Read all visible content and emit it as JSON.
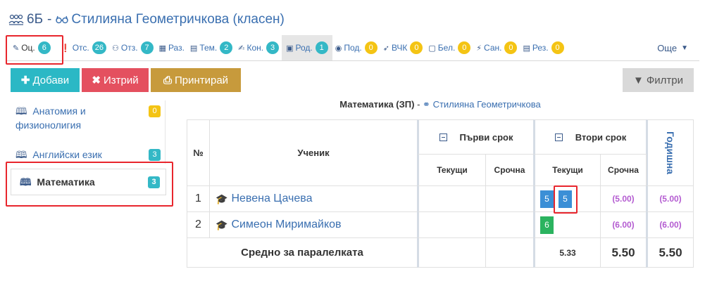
{
  "header": {
    "class_name": "6Б",
    "separator": "-",
    "teacher": "Стилияна Геометричкова (класен)"
  },
  "tabs": [
    {
      "icon": "pencil-icon",
      "label": "Оц.",
      "badge": "6",
      "badge_color": "teal"
    },
    {
      "icon": "exclamation-icon",
      "label": "Отс.",
      "badge": "26",
      "badge_color": "teal"
    },
    {
      "icon": "user-icon",
      "label": "Отз.",
      "badge": "7",
      "badge_color": "teal"
    },
    {
      "icon": "grid-icon",
      "label": "Раз.",
      "badge": "",
      "badge_color": ""
    },
    {
      "icon": "list-icon",
      "label": "Тем.",
      "badge": "2",
      "badge_color": "teal"
    },
    {
      "icon": "edit-icon",
      "label": "Кон.",
      "badge": "3",
      "badge_color": "teal"
    },
    {
      "icon": "calendar-icon",
      "label": "Род.",
      "badge": "1",
      "badge_color": "teal"
    },
    {
      "icon": "eye-icon",
      "label": "Под.",
      "badge": "0",
      "badge_color": "yellow"
    },
    {
      "icon": "rocket-icon",
      "label": "ВЧК",
      "badge": "0",
      "badge_color": "yellow"
    },
    {
      "icon": "note-icon",
      "label": "Бел.",
      "badge": "0",
      "badge_color": "yellow"
    },
    {
      "icon": "bolt-icon",
      "label": "Сан.",
      "badge": "0",
      "badge_color": "yellow"
    },
    {
      "icon": "document-icon",
      "label": "Рез.",
      "badge": "0",
      "badge_color": "yellow"
    }
  ],
  "more_label": "Още",
  "buttons": {
    "add": "Добави",
    "delete": "Изтрий",
    "print": "Принтирай",
    "filter": "Филтри"
  },
  "subjects": [
    {
      "line1": "Анатомия и",
      "line2": "физионолигия",
      "badge": "0",
      "badge_color": "#f4c414"
    },
    {
      "line1": "Английски език",
      "line2": "",
      "badge": "3",
      "badge_color": "#34b8c6"
    },
    {
      "line1": "Математика",
      "line2": "",
      "badge": "3",
      "badge_color": "#34b8c6"
    }
  ],
  "table": {
    "subject": "Математика (ЗП)",
    "separator": "-",
    "teacher": "Стилияна Геометричкова",
    "col_no": "№",
    "col_student": "Ученик",
    "term1": "Първи срок",
    "term2": "Втори срок",
    "annual": "Годишна",
    "current": "Текущи",
    "term_grade": "Срочна",
    "rows": [
      {
        "no": "1",
        "name": "Невена Цачева",
        "t2_current": [
          "5",
          "5"
        ],
        "t2_term": "(5.00)",
        "annual": "(5.00)"
      },
      {
        "no": "2",
        "name": "Симеон Миримайков",
        "t2_current": [
          "6"
        ],
        "t2_term": "(6.00)",
        "annual": "(6.00)"
      }
    ],
    "avg_label": "Средно за паралелката",
    "avg_current": "5.33",
    "avg_term": "5.50",
    "avg_annual": "5.50"
  }
}
